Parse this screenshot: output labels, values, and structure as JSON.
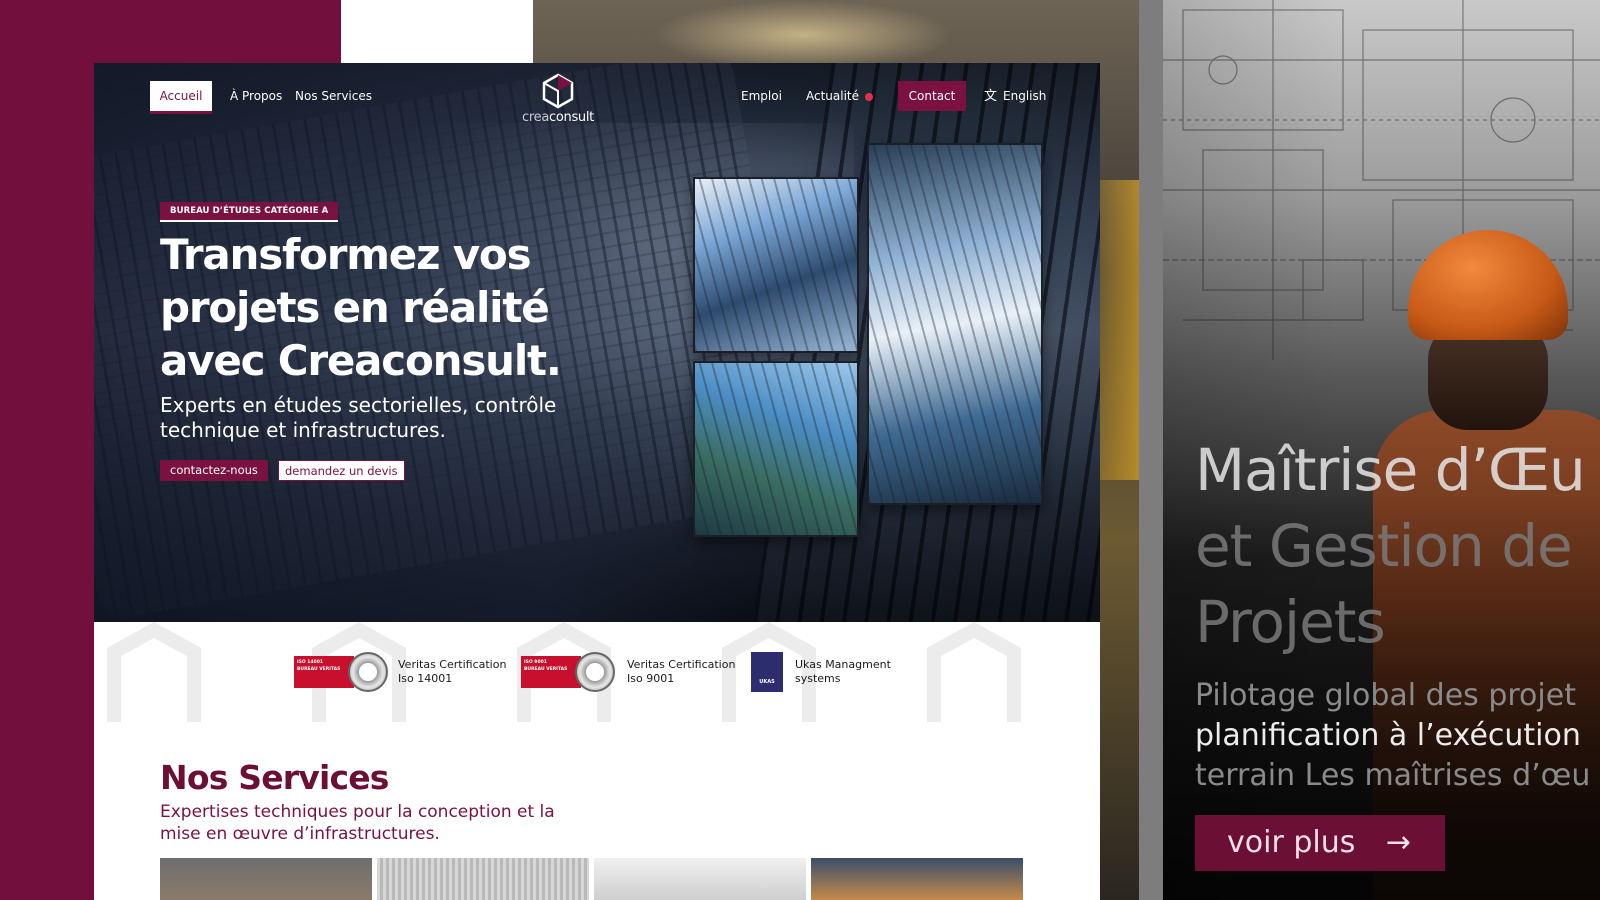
{
  "nav": {
    "home": "Accueil",
    "about": "À Propos",
    "services": "Nos Services",
    "jobs": "Emploi",
    "news": "Actualité",
    "contact": "Contact",
    "language": "English"
  },
  "logo": {
    "crea": "crea",
    "consult": "consult"
  },
  "hero": {
    "badge": "BUREAU D’ÉTUDES CATÉGORIE A",
    "title": "Transformez vos projets en réalité avec Creaconsult.",
    "subtitle": "Experts en études sectorielles, contrôle technique et infrastructures.",
    "cta_primary": "contactez-nous",
    "cta_secondary": "demandez un devis"
  },
  "certifications": [
    {
      "logo_label": "ISO 14001",
      "logo_sub": "BUREAU VERITAS",
      "line1": "Veritas Certification",
      "line2": "Iso 14001"
    },
    {
      "logo_label": "ISO 9001",
      "logo_sub": "BUREAU VERITAS",
      "line1": "Veritas Certification",
      "line2": "Iso 9001"
    },
    {
      "logo_label": "UKAS",
      "line1": "Ukas Managment",
      "line2": "systems"
    }
  ],
  "services": {
    "title": "Nos Services",
    "subtitle": "Expertises techniques pour la conception et la mise en œuvre d’infrastructures."
  },
  "preview": {
    "title_line1": "Maîtrise d’Œu",
    "title_line2": "et Gestion de",
    "title_line3": "Projets",
    "sub_line1": "Pilotage global des projet",
    "sub_line2": "planification à l’exécution",
    "sub_line3": "terrain Les maîtrises d’œu",
    "button": "voir plus"
  },
  "colors": {
    "brand": "#7a1140",
    "brand_dark": "#6b0f35",
    "news_dot": "#e0324f",
    "certification_red": "#c8102e"
  },
  "icons": [
    "logo-cube-icon",
    "translate-icon",
    "arrow-right-icon",
    "news-dot-icon"
  ]
}
